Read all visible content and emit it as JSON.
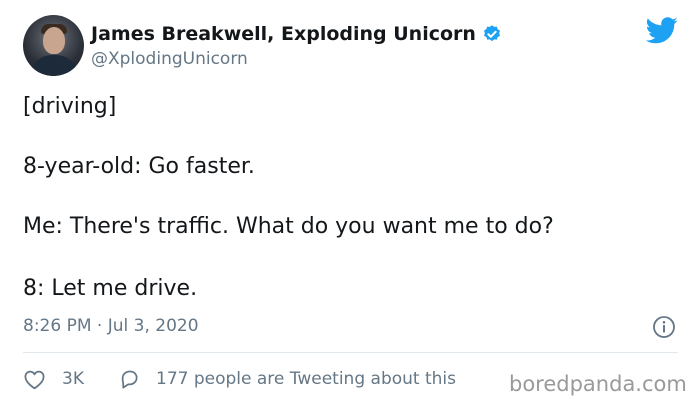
{
  "tweet": {
    "author_name": "James Breakwell, Exploding Unicorn",
    "handle": "@XplodingUnicorn",
    "lines": [
      "[driving]",
      "8-year-old: Go faster.",
      "Me: There's traffic. What do you want me to do?",
      "8: Let me drive."
    ],
    "timestamp": "8:26 PM · Jul 3, 2020",
    "likes": "3K",
    "tweeting_text": "177 people are Tweeting about this"
  },
  "watermark": "boredpanda.com",
  "icons": {
    "verified": "verified-badge-icon",
    "brand": "twitter-bird-icon",
    "info": "info-icon",
    "like": "heart-icon",
    "reply": "speech-bubble-icon"
  },
  "colors": {
    "twitter_blue": "#1da1f2",
    "secondary_text": "#657786",
    "primary_text": "#14171a"
  }
}
